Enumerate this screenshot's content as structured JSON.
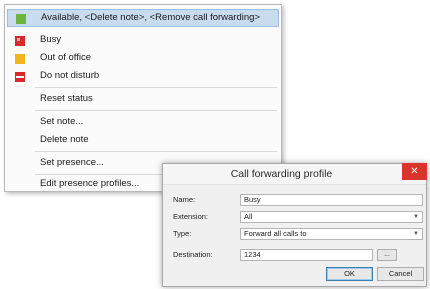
{
  "menu": {
    "items": [
      {
        "label": "Available, <Delete note>, <Remove call forwarding>",
        "icon": "available-status-icon",
        "color": "#6cb33f"
      },
      {
        "label": "Busy",
        "icon": "busy-status-icon",
        "color": "#d92b2b"
      },
      {
        "label": "Out of office",
        "icon": "out-of-office-status-icon",
        "color": "#f2b51b"
      },
      {
        "label": "Do not disturb",
        "icon": "do-not-disturb-status-icon",
        "color": "#d92b2b"
      },
      {
        "label": "Reset status"
      },
      {
        "label": "Set note..."
      },
      {
        "label": "Delete note"
      },
      {
        "label": "Set presence..."
      },
      {
        "label": "Edit presence profiles..."
      }
    ]
  },
  "dialog": {
    "title": "Call forwarding profile",
    "close_label": "✕",
    "fields": {
      "name": {
        "label": "Name:",
        "value": "Busy"
      },
      "extension": {
        "label": "Extension:",
        "value": "All"
      },
      "type": {
        "label": "Type:",
        "value": "Forward all calls to"
      },
      "destination": {
        "label": "Destination:",
        "value": "1234"
      }
    },
    "browse_label": "...",
    "ok_label": "OK",
    "cancel_label": "Cancel"
  }
}
